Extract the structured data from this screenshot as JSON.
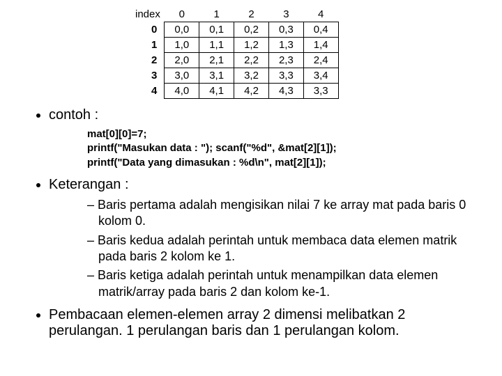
{
  "table": {
    "index_label": "index",
    "col_headers": [
      "0",
      "1",
      "2",
      "3",
      "4"
    ],
    "row_headers": [
      "0",
      "1",
      "2",
      "3",
      "4"
    ],
    "cells": [
      [
        "0,0",
        "0,1",
        "0,2",
        "0,3",
        "0,4"
      ],
      [
        "1,0",
        "1,1",
        "1,2",
        "1,3",
        "1,4"
      ],
      [
        "2,0",
        "2,1",
        "2,2",
        "2,3",
        "2,4"
      ],
      [
        "3,0",
        "3,1",
        "3,2",
        "3,3",
        "3,4"
      ],
      [
        "4,0",
        "4,1",
        "4,2",
        "4,3",
        "3,3"
      ]
    ]
  },
  "bullets": {
    "contoh_label": "contoh :",
    "code": {
      "l1": "mat[0][0]=7;",
      "l2": "printf(\"Masukan data : \"); scanf(\"%d\", &mat[2][1]);",
      "l3": "printf(\"Data yang dimasukan : %d\\n\", mat[2][1]);"
    },
    "keterangan_label": "Keterangan :",
    "ket": {
      "i1": "Baris pertama adalah mengisikan nilai 7 ke array mat pada baris 0 kolom 0.",
      "i2": "Baris kedua adalah perintah untuk membaca data elemen matrik pada baris 2 kolom ke 1.",
      "i3": "Baris ketiga adalah perintah untuk menampilkan data elemen matrik/array pada baris 2 dan kolom ke-1."
    },
    "final": "Pembacaan elemen-elemen array 2 dimensi melibatkan 2 perulangan. 1 perulangan baris dan 1 perulangan kolom."
  }
}
